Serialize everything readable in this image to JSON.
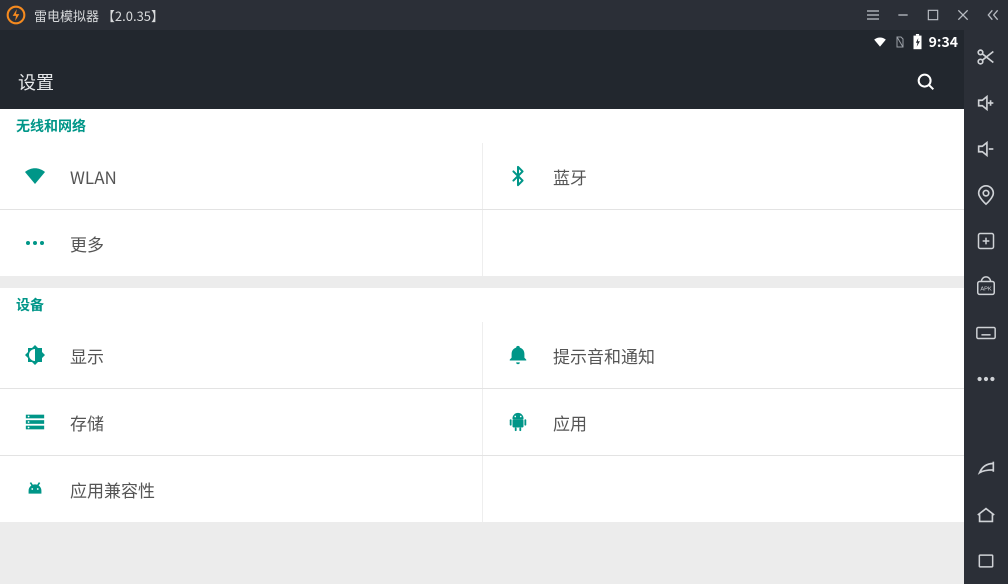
{
  "window": {
    "title": "雷电模拟器  【2.0.35】"
  },
  "statusbar": {
    "clock": "9:34"
  },
  "appbar": {
    "title": "设置"
  },
  "sections": {
    "wireless": {
      "header": "无线和网络",
      "wlan": "WLAN",
      "bluetooth": "蓝牙",
      "more": "更多"
    },
    "device": {
      "header": "设备",
      "display": "显示",
      "sound": "提示音和通知",
      "storage": "存储",
      "apps": "应用",
      "compat": "应用兼容性"
    }
  }
}
